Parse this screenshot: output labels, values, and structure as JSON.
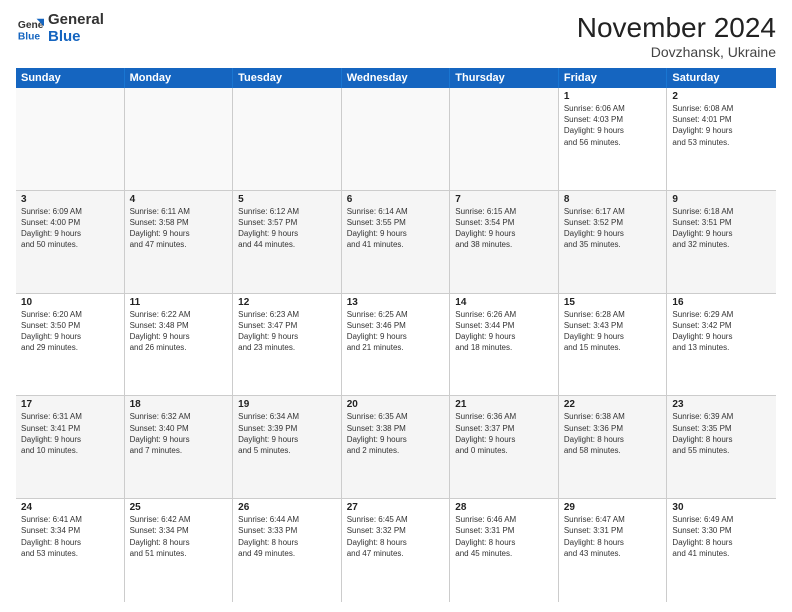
{
  "logo": {
    "line1": "General",
    "line2": "Blue"
  },
  "title": "November 2024",
  "subtitle": "Dovzhansk, Ukraine",
  "header_days": [
    "Sunday",
    "Monday",
    "Tuesday",
    "Wednesday",
    "Thursday",
    "Friday",
    "Saturday"
  ],
  "weeks": [
    [
      {
        "day": "",
        "info": [],
        "empty": true
      },
      {
        "day": "",
        "info": [],
        "empty": true
      },
      {
        "day": "",
        "info": [],
        "empty": true
      },
      {
        "day": "",
        "info": [],
        "empty": true
      },
      {
        "day": "",
        "info": [],
        "empty": true
      },
      {
        "day": "1",
        "info": [
          "Sunrise: 6:06 AM",
          "Sunset: 4:03 PM",
          "Daylight: 9 hours",
          "and 56 minutes."
        ]
      },
      {
        "day": "2",
        "info": [
          "Sunrise: 6:08 AM",
          "Sunset: 4:01 PM",
          "Daylight: 9 hours",
          "and 53 minutes."
        ]
      }
    ],
    [
      {
        "day": "3",
        "info": [
          "Sunrise: 6:09 AM",
          "Sunset: 4:00 PM",
          "Daylight: 9 hours",
          "and 50 minutes."
        ],
        "alt": true
      },
      {
        "day": "4",
        "info": [
          "Sunrise: 6:11 AM",
          "Sunset: 3:58 PM",
          "Daylight: 9 hours",
          "and 47 minutes."
        ],
        "alt": true
      },
      {
        "day": "5",
        "info": [
          "Sunrise: 6:12 AM",
          "Sunset: 3:57 PM",
          "Daylight: 9 hours",
          "and 44 minutes."
        ],
        "alt": true
      },
      {
        "day": "6",
        "info": [
          "Sunrise: 6:14 AM",
          "Sunset: 3:55 PM",
          "Daylight: 9 hours",
          "and 41 minutes."
        ],
        "alt": true
      },
      {
        "day": "7",
        "info": [
          "Sunrise: 6:15 AM",
          "Sunset: 3:54 PM",
          "Daylight: 9 hours",
          "and 38 minutes."
        ],
        "alt": true
      },
      {
        "day": "8",
        "info": [
          "Sunrise: 6:17 AM",
          "Sunset: 3:52 PM",
          "Daylight: 9 hours",
          "and 35 minutes."
        ],
        "alt": true
      },
      {
        "day": "9",
        "info": [
          "Sunrise: 6:18 AM",
          "Sunset: 3:51 PM",
          "Daylight: 9 hours",
          "and 32 minutes."
        ],
        "alt": true
      }
    ],
    [
      {
        "day": "10",
        "info": [
          "Sunrise: 6:20 AM",
          "Sunset: 3:50 PM",
          "Daylight: 9 hours",
          "and 29 minutes."
        ]
      },
      {
        "day": "11",
        "info": [
          "Sunrise: 6:22 AM",
          "Sunset: 3:48 PM",
          "Daylight: 9 hours",
          "and 26 minutes."
        ]
      },
      {
        "day": "12",
        "info": [
          "Sunrise: 6:23 AM",
          "Sunset: 3:47 PM",
          "Daylight: 9 hours",
          "and 23 minutes."
        ]
      },
      {
        "day": "13",
        "info": [
          "Sunrise: 6:25 AM",
          "Sunset: 3:46 PM",
          "Daylight: 9 hours",
          "and 21 minutes."
        ]
      },
      {
        "day": "14",
        "info": [
          "Sunrise: 6:26 AM",
          "Sunset: 3:44 PM",
          "Daylight: 9 hours",
          "and 18 minutes."
        ]
      },
      {
        "day": "15",
        "info": [
          "Sunrise: 6:28 AM",
          "Sunset: 3:43 PM",
          "Daylight: 9 hours",
          "and 15 minutes."
        ]
      },
      {
        "day": "16",
        "info": [
          "Sunrise: 6:29 AM",
          "Sunset: 3:42 PM",
          "Daylight: 9 hours",
          "and 13 minutes."
        ]
      }
    ],
    [
      {
        "day": "17",
        "info": [
          "Sunrise: 6:31 AM",
          "Sunset: 3:41 PM",
          "Daylight: 9 hours",
          "and 10 minutes."
        ],
        "alt": true
      },
      {
        "day": "18",
        "info": [
          "Sunrise: 6:32 AM",
          "Sunset: 3:40 PM",
          "Daylight: 9 hours",
          "and 7 minutes."
        ],
        "alt": true
      },
      {
        "day": "19",
        "info": [
          "Sunrise: 6:34 AM",
          "Sunset: 3:39 PM",
          "Daylight: 9 hours",
          "and 5 minutes."
        ],
        "alt": true
      },
      {
        "day": "20",
        "info": [
          "Sunrise: 6:35 AM",
          "Sunset: 3:38 PM",
          "Daylight: 9 hours",
          "and 2 minutes."
        ],
        "alt": true
      },
      {
        "day": "21",
        "info": [
          "Sunrise: 6:36 AM",
          "Sunset: 3:37 PM",
          "Daylight: 9 hours",
          "and 0 minutes."
        ],
        "alt": true
      },
      {
        "day": "22",
        "info": [
          "Sunrise: 6:38 AM",
          "Sunset: 3:36 PM",
          "Daylight: 8 hours",
          "and 58 minutes."
        ],
        "alt": true
      },
      {
        "day": "23",
        "info": [
          "Sunrise: 6:39 AM",
          "Sunset: 3:35 PM",
          "Daylight: 8 hours",
          "and 55 minutes."
        ],
        "alt": true
      }
    ],
    [
      {
        "day": "24",
        "info": [
          "Sunrise: 6:41 AM",
          "Sunset: 3:34 PM",
          "Daylight: 8 hours",
          "and 53 minutes."
        ]
      },
      {
        "day": "25",
        "info": [
          "Sunrise: 6:42 AM",
          "Sunset: 3:34 PM",
          "Daylight: 8 hours",
          "and 51 minutes."
        ]
      },
      {
        "day": "26",
        "info": [
          "Sunrise: 6:44 AM",
          "Sunset: 3:33 PM",
          "Daylight: 8 hours",
          "and 49 minutes."
        ]
      },
      {
        "day": "27",
        "info": [
          "Sunrise: 6:45 AM",
          "Sunset: 3:32 PM",
          "Daylight: 8 hours",
          "and 47 minutes."
        ]
      },
      {
        "day": "28",
        "info": [
          "Sunrise: 6:46 AM",
          "Sunset: 3:31 PM",
          "Daylight: 8 hours",
          "and 45 minutes."
        ]
      },
      {
        "day": "29",
        "info": [
          "Sunrise: 6:47 AM",
          "Sunset: 3:31 PM",
          "Daylight: 8 hours",
          "and 43 minutes."
        ]
      },
      {
        "day": "30",
        "info": [
          "Sunrise: 6:49 AM",
          "Sunset: 3:30 PM",
          "Daylight: 8 hours",
          "and 41 minutes."
        ]
      }
    ]
  ]
}
